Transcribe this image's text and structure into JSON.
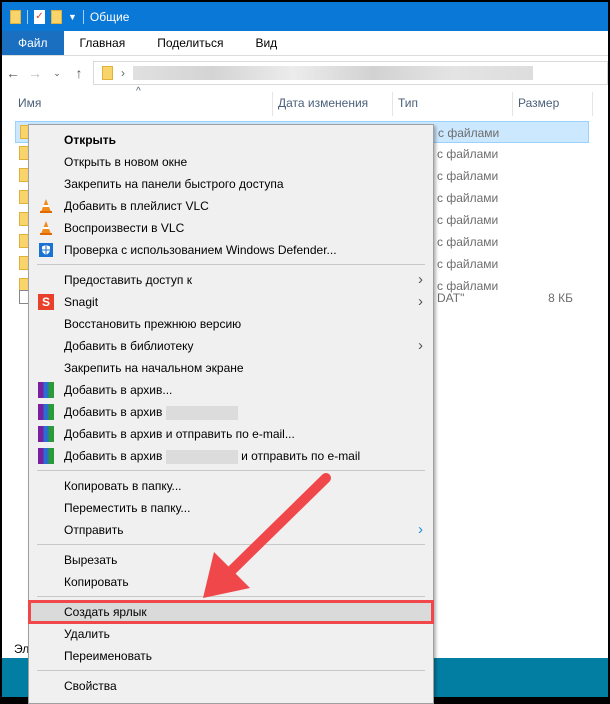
{
  "window": {
    "title": "Общие"
  },
  "ribbon": {
    "tabs": [
      "Файл",
      "Главная",
      "Поделиться",
      "Вид"
    ]
  },
  "columns": {
    "name": "Имя",
    "date": "Дата изменения",
    "type": "Тип",
    "size": "Размер"
  },
  "rows": [
    {
      "type": "с файлами",
      "size": ""
    },
    {
      "type": "с файлами",
      "size": ""
    },
    {
      "type": "с файлами",
      "size": ""
    },
    {
      "type": "с файлами",
      "size": ""
    },
    {
      "type": "с файлами",
      "size": ""
    },
    {
      "type": "с файлами",
      "size": ""
    },
    {
      "type": "с файлами",
      "size": ""
    },
    {
      "type": "с файлами",
      "size": ""
    },
    {
      "type": "DAT\"",
      "size": "8 КБ"
    }
  ],
  "status": "Эл",
  "menu": {
    "open": "Открыть",
    "open_new": "Открыть в новом окне",
    "pin_quick": "Закрепить на панели быстрого доступа",
    "vlc_add": "Добавить в плейлист VLC",
    "vlc_play": "Воспроизвести в VLC",
    "defender": "Проверка с использованием Windows Defender...",
    "share": "Предоставить доступ к",
    "snagit": "Snagit",
    "restore": "Восстановить прежнюю версию",
    "library": "Добавить в библиотеку",
    "pin_start": "Закрепить на начальном экране",
    "archive": "Добавить в архив...",
    "archive_named": "Добавить в архив",
    "archive_email": "Добавить в архив и отправить по e-mail...",
    "archive_named_email_a": "Добавить в архив",
    "archive_named_email_b": "и отправить по e-mail",
    "copy_to": "Копировать в папку...",
    "move_to": "Переместить в папку...",
    "send": "Отправить",
    "cut": "Вырезать",
    "copy": "Копировать",
    "shortcut": "Создать ярлык",
    "delete": "Удалить",
    "rename": "Переименовать",
    "properties": "Свойства"
  },
  "colors": {
    "accent": "#0a78d7",
    "highlight": "#f0474a",
    "teal": "#017ea1"
  }
}
